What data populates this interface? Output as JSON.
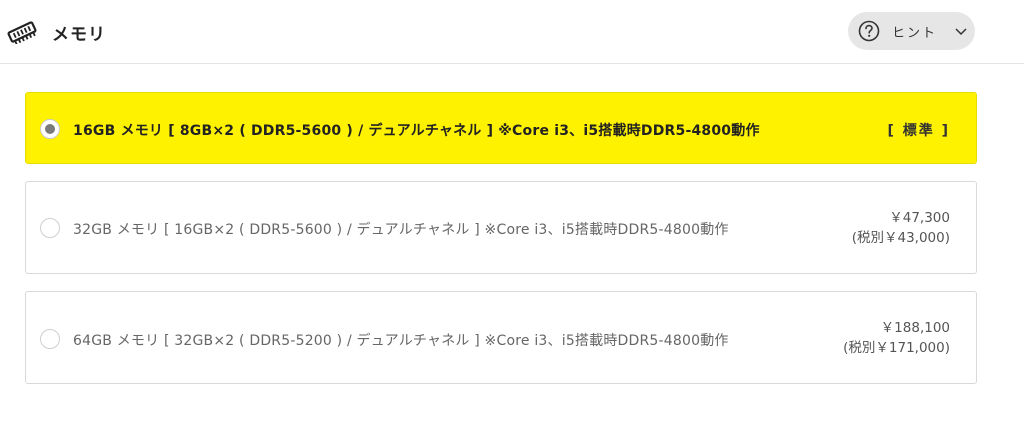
{
  "header": {
    "title": "メモリ",
    "icon": "memory-chip-icon",
    "hint_label": "ヒント",
    "hint_icon": "question-circle-icon",
    "chevron_icon": "chevron-down-icon"
  },
  "options": [
    {
      "label": "16GB メモリ [ 8GB×2 ( DDR5-5600 ) / デュアルチャネル ] ※Core i3、i5搭載時DDR5-4800動作",
      "standard_label": "[ 標準 ]",
      "selected": true
    },
    {
      "label": "32GB メモリ [ 16GB×2 ( DDR5-5600 ) / デュアルチャネル ] ※Core i3、i5搭載時DDR5-4800動作",
      "price": "￥47,300",
      "price_ex_tax": "(税別￥43,000)",
      "selected": false
    },
    {
      "label": "64GB メモリ [ 32GB×2 ( DDR5-5200 ) / デュアルチャネル ] ※Core i3、i5搭載時DDR5-4800動作",
      "price": "￥188,100",
      "price_ex_tax": "(税別￥171,000)",
      "selected": false
    }
  ],
  "colors": {
    "selected_background": "#fff200",
    "border": "#d9d9d9",
    "hint_background": "#e6e6e6"
  }
}
